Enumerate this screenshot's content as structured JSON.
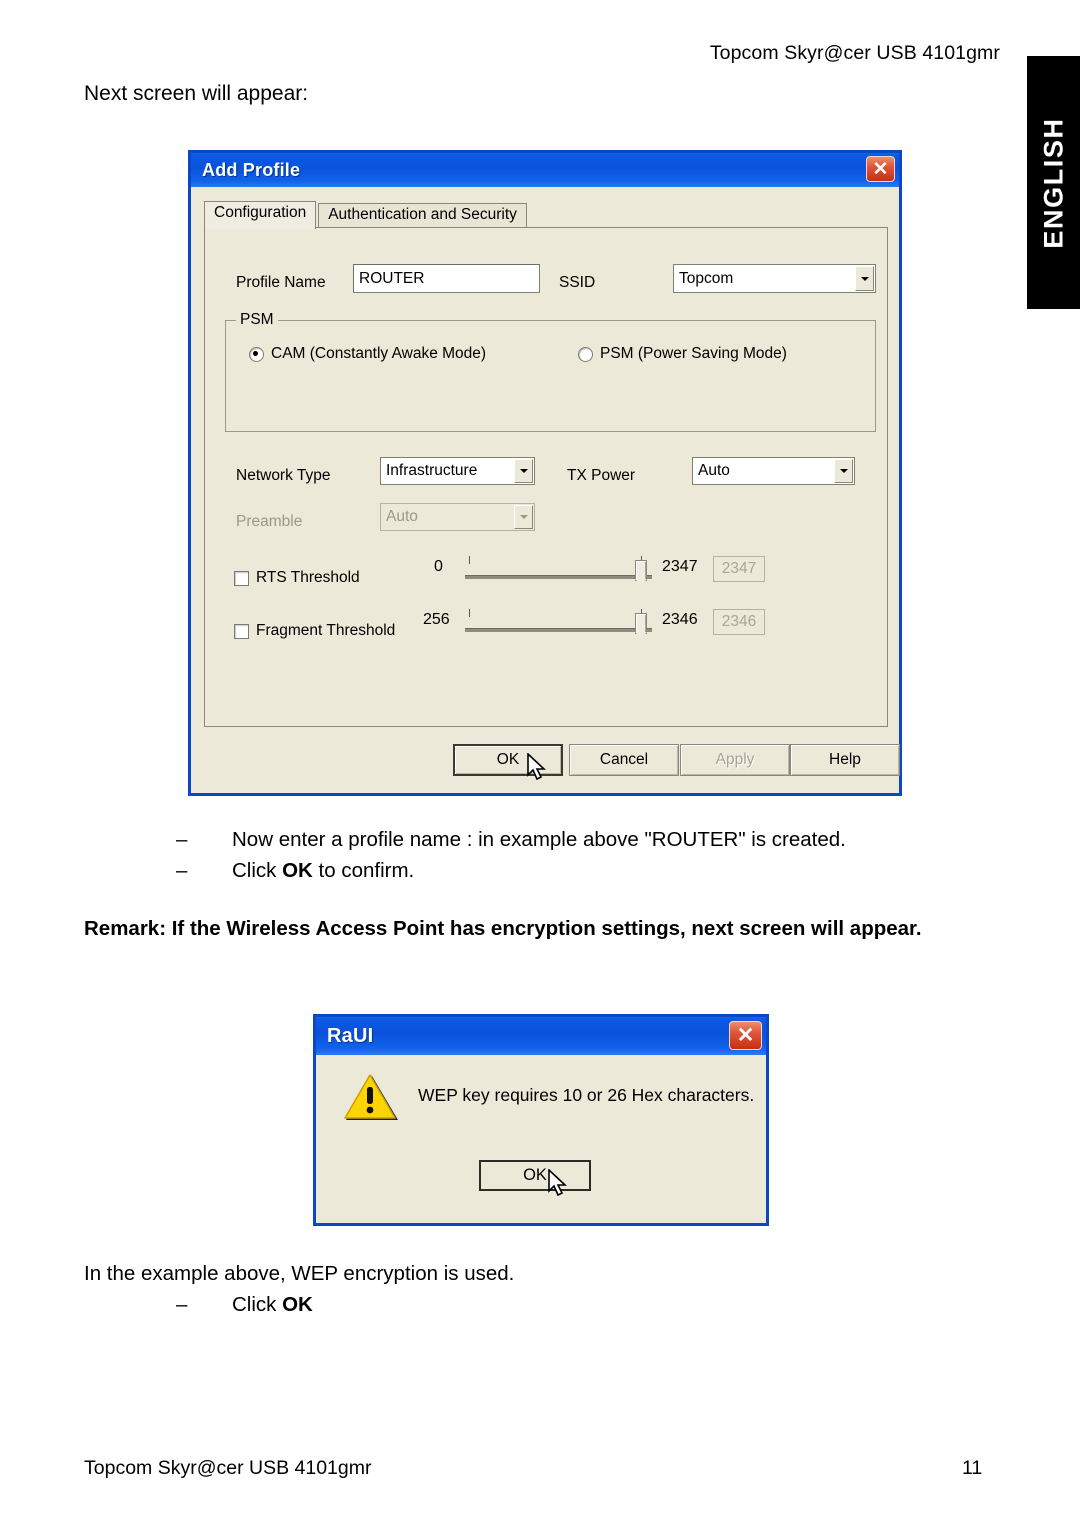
{
  "page": {
    "header_right": "Topcom Skyr@cer USB 4101gmr",
    "intro": "Next screen will appear:",
    "footer_left": "Topcom Skyr@cer USB 4101gmr",
    "footer_page_number": "11",
    "side_tab_label": "ENGLISH"
  },
  "bullets": {
    "dash": "–",
    "items": [
      {
        "pre": "Now enter a profile name : in example above \"ROUTER\" is created.",
        "bold": "",
        "post": ""
      },
      {
        "pre": "Click ",
        "bold": "OK",
        "post": " to confirm."
      }
    ]
  },
  "remark": {
    "text": "Remark: If the Wireless Access Point has encryption settings, next screen will appear."
  },
  "closing": {
    "line1": "In the example above, WEP encryption is used.",
    "dash": "–",
    "line2_pre": "Click ",
    "line2_bold": "OK"
  },
  "add_profile_dialog": {
    "title": "Add Profile",
    "close_icon": "close-icon",
    "close_glyph": "✕",
    "tabs": [
      {
        "label": "Configuration",
        "active": true
      },
      {
        "label": "Authentication and Security",
        "active": false
      }
    ],
    "profile_name": {
      "label": "Profile Name",
      "value": "ROUTER"
    },
    "ssid": {
      "label": "SSID",
      "value": "Topcom"
    },
    "psm": {
      "group_title": "PSM",
      "options": [
        {
          "label": "CAM (Constantly Awake Mode)",
          "checked": true
        },
        {
          "label": "PSM (Power Saving Mode)",
          "checked": false
        }
      ]
    },
    "network_type": {
      "label": "Network Type",
      "value": "Infrastructure"
    },
    "tx_power": {
      "label": "TX Power",
      "value": "Auto"
    },
    "preamble": {
      "label": "Preamble",
      "value": "Auto",
      "disabled": true
    },
    "rts_threshold": {
      "label": "RTS Threshold",
      "checked": false,
      "min": "0",
      "max": "2347",
      "value": "2347"
    },
    "fragment_threshold": {
      "label": "Fragment Threshold",
      "checked": false,
      "min": "256",
      "max": "2346",
      "value": "2346"
    },
    "buttons": [
      {
        "label": "OK",
        "state": "default"
      },
      {
        "label": "Cancel",
        "state": "normal"
      },
      {
        "label": "Apply",
        "state": "disabled"
      },
      {
        "label": "Help",
        "state": "normal"
      }
    ]
  },
  "raui_dialog": {
    "title": "RaUI",
    "close_glyph": "✕",
    "icon": "warning-triangle-icon",
    "message": "WEP key requires 10 or 26 Hex characters.",
    "ok_label": "OK"
  },
  "colors": {
    "titlebar_blue": "#0a52dc",
    "dialog_face": "#ece9d8",
    "border_blue": "#0a48c8",
    "close_red": "#c62f12",
    "warning_yellow": "#ffd400",
    "tab_black": "#000000"
  }
}
